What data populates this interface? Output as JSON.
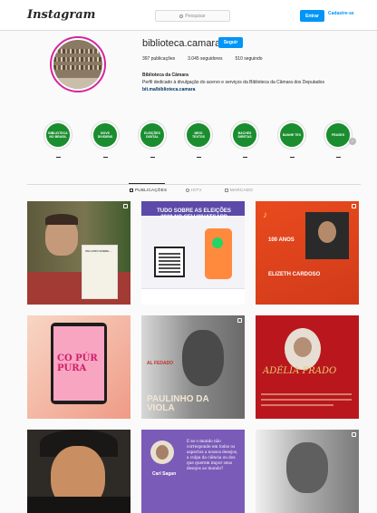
{
  "topbar": {
    "logo": "Instagram",
    "search_placeholder": "Pesquisar",
    "login_label": "Entrar",
    "signup_label": "Cadastre-se"
  },
  "profile": {
    "username": "biblioteca.camara",
    "follow_label": "Seguir",
    "stats": {
      "posts": "397 publicações",
      "followers": "3.045 seguidores",
      "following": "510 seguindo"
    },
    "bio": {
      "name": "Biblioteca da Câmara",
      "description": "Perfil dedicado à divulgação do acervo e serviços da Biblioteca da Câmara dos Deputados",
      "link": "bit.ma/biblioteca.camara"
    }
  },
  "highlights": [
    {
      "label": "BIBLIOTECA NO BRASIL"
    },
    {
      "label": "NOVE DIVIDENS"
    },
    {
      "label": "ELEIÇÕES DIGITAL"
    },
    {
      "label": "MEIO TEXTOS"
    },
    {
      "label": "BACHES DIRETAS"
    },
    {
      "label": "BANHE TEX"
    },
    {
      "label": "FRASES"
    }
  ],
  "tabs": [
    {
      "label": "PUBLICAÇÕES"
    },
    {
      "label": "IGTV"
    },
    {
      "label": "MARCADO"
    }
  ],
  "posts": [
    {
      "text": "UM LIVRO SOBRE..."
    },
    {
      "text": "TUDO SOBRE AS ELEIÇÕES 2020 NO SEU WHATSAPP"
    },
    {
      "text": "100 ANOS",
      "subtext": "ELIZETH CARDOSO"
    },
    {
      "text": "CO PÚR PURA"
    },
    {
      "text": "PAULINHO DA VIOLA",
      "subtext": "AL FEDADO"
    },
    {
      "text": "ADÉLIA PRADO"
    },
    {
      "text": ""
    },
    {
      "text": "E se o mundo não corresponde em todos os aspectos a nossos desejos, a culpa da ciência ou dos que querem impor seus desejos ao mundo?",
      "subtext": "Carl Sagan"
    },
    {
      "text": ""
    }
  ],
  "colors": {
    "accent": "#0095f6",
    "highlight_green": "#1a8d2f",
    "story_ring": "#d6249f"
  }
}
